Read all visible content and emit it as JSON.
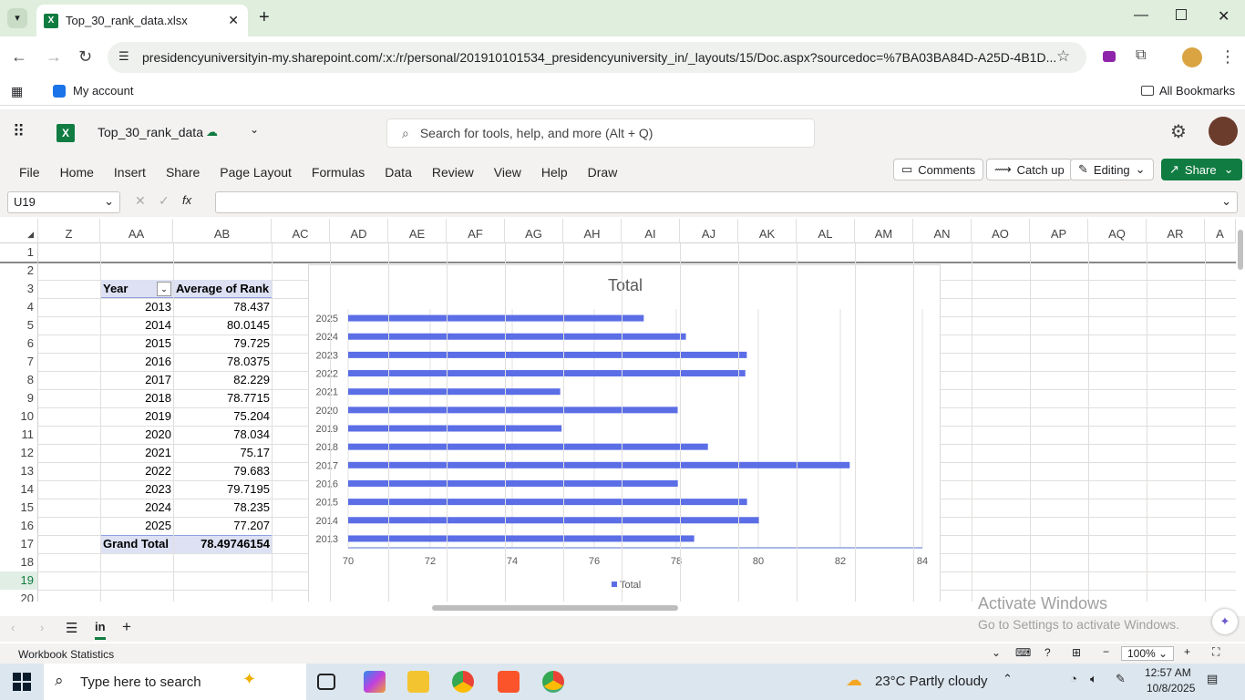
{
  "browser": {
    "tab_title": "Top_30_rank_data.xlsx",
    "url": "presidencyuniversityin-my.sharepoint.com/:x:/r/personal/201910101534_presidencyuniversity_in/_layouts/15/Doc.aspx?sourcedoc=%7BA03BA84D-A25D-4B1D...",
    "bookmark_my_account": "My account",
    "all_bookmarks": "All Bookmarks"
  },
  "excel": {
    "file_name": "Top_30_rank_data",
    "search_placeholder": "Search for tools, help, and more (Alt + Q)",
    "menu": [
      "File",
      "Home",
      "Insert",
      "Share",
      "Page Layout",
      "Formulas",
      "Data",
      "Review",
      "View",
      "Help",
      "Draw"
    ],
    "comments": "Comments",
    "catch_up": "Catch up",
    "editing": "Editing",
    "share": "Share",
    "name_box": "U19",
    "fx": "fx"
  },
  "grid": {
    "columns": [
      "Z",
      "AA",
      "AB",
      "AC",
      "AD",
      "AE",
      "AF",
      "AG",
      "AH",
      "AI",
      "AJ",
      "AK",
      "AL",
      "AM",
      "AN",
      "AO",
      "AP",
      "AQ",
      "AR",
      "A"
    ],
    "rows": [
      "1",
      "2",
      "3",
      "4",
      "5",
      "6",
      "7",
      "8",
      "9",
      "10",
      "11",
      "12",
      "13",
      "14",
      "15",
      "16",
      "17",
      "18",
      "19",
      "20"
    ],
    "pivot_header_year": "Year",
    "pivot_header_avg": "Average of Rank",
    "pivot_rows": [
      {
        "year": "2013",
        "avg": "78.437"
      },
      {
        "year": "2014",
        "avg": "80.0145"
      },
      {
        "year": "2015",
        "avg": "79.725"
      },
      {
        "year": "2016",
        "avg": "78.0375"
      },
      {
        "year": "2017",
        "avg": "82.229"
      },
      {
        "year": "2018",
        "avg": "78.7715"
      },
      {
        "year": "2019",
        "avg": "75.204"
      },
      {
        "year": "2020",
        "avg": "78.034"
      },
      {
        "year": "2021",
        "avg": "75.17"
      },
      {
        "year": "2022",
        "avg": "79.683"
      },
      {
        "year": "2023",
        "avg": "79.7195"
      },
      {
        "year": "2024",
        "avg": "78.235"
      },
      {
        "year": "2025",
        "avg": "77.207"
      }
    ],
    "grand_total_label": "Grand Total",
    "grand_total_value": "78.49746154"
  },
  "chart_data": {
    "type": "bar",
    "orientation": "horizontal",
    "title": "Total",
    "categories": [
      "2013",
      "2014",
      "2015",
      "2016",
      "2017",
      "2018",
      "2019",
      "2020",
      "2021",
      "2022",
      "2023",
      "2024",
      "2025"
    ],
    "series": [
      {
        "name": "Total",
        "values": [
          78.437,
          80.0145,
          79.725,
          78.0375,
          82.229,
          78.7715,
          75.204,
          78.034,
          75.17,
          79.683,
          79.7195,
          78.235,
          77.207
        ]
      }
    ],
    "xlim": [
      70,
      84
    ],
    "xticks": [
      "70",
      "72",
      "74",
      "76",
      "78",
      "80",
      "82",
      "84"
    ],
    "grid": true,
    "legend": "bottom",
    "bar_color": "#5b6ee6"
  },
  "sheets": {
    "active": "in"
  },
  "status": {
    "left": "Workbook Statistics",
    "zoom": "100%",
    "activate_title": "Activate Windows",
    "activate_sub": "Go to Settings to activate Windows."
  },
  "taskbar": {
    "search": "Type here to search",
    "weather": "23°C  Partly cloudy",
    "time": "12:57 AM",
    "date": "10/8/2025"
  }
}
